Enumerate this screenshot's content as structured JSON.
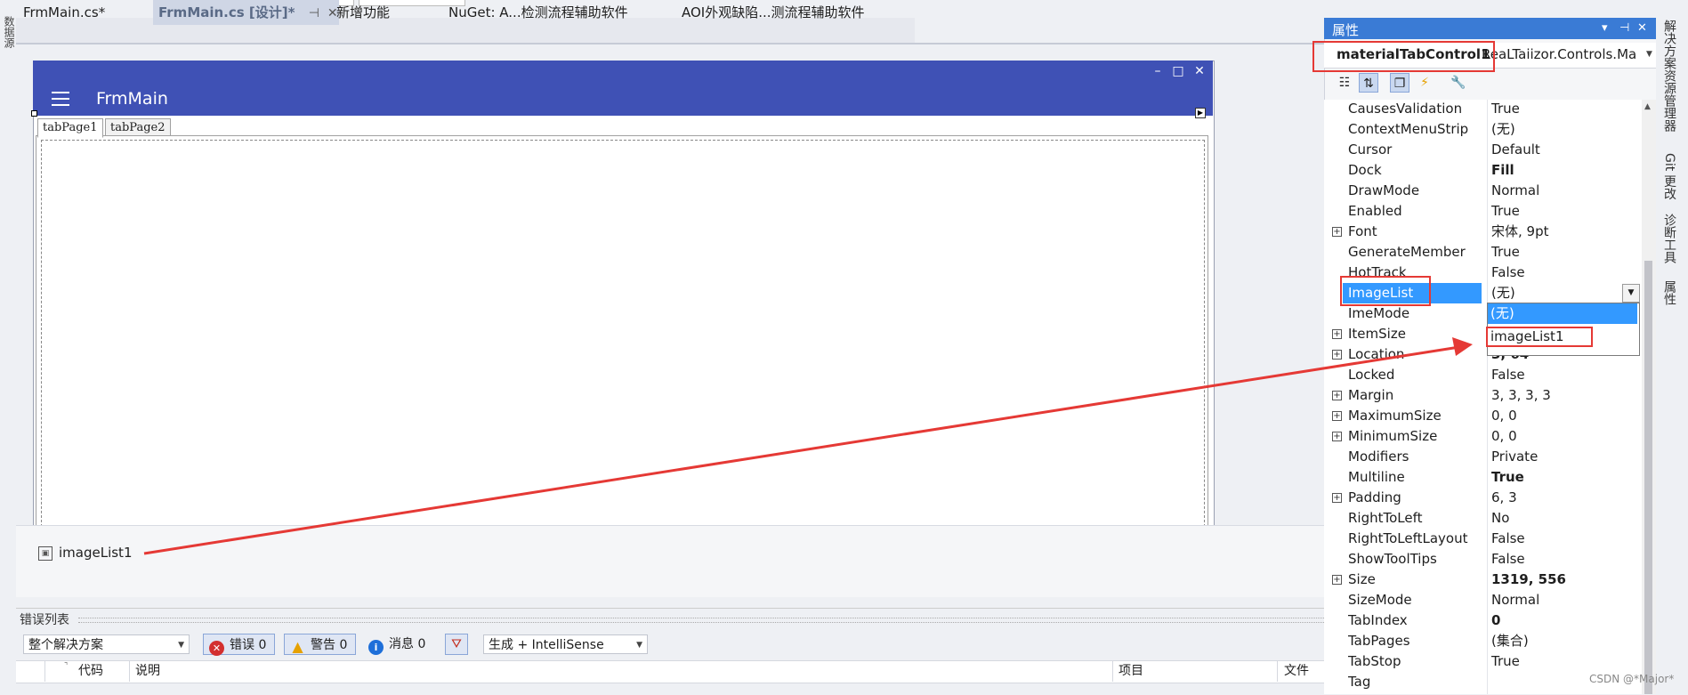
{
  "left_strip": {
    "label": "数据源"
  },
  "doc_tabs": [
    {
      "label": "FrmMain.cs*"
    },
    {
      "label": "FrmMain.cs [设计]*",
      "pin": "⊣",
      "close": "✕"
    },
    {
      "label": "新增功能"
    },
    {
      "label": "NuGet: A...检测流程辅助软件"
    },
    {
      "label": "AOI外观缺陷...测流程辅助软件"
    }
  ],
  "form": {
    "title": "FrmMain",
    "window_buttons": {
      "minimize": "–",
      "maximize": "□",
      "close": "✕"
    },
    "tabs": [
      "tabPage1",
      "tabPage2"
    ]
  },
  "tray": {
    "component": "imageList1"
  },
  "error_list": {
    "title": "错误列表",
    "scope": "整个解决方案",
    "errors": "错误 0",
    "warnings": "警告 0",
    "messages": "消息 0",
    "build_filter": "生成 + IntelliSense",
    "columns": [
      "代码",
      "说明",
      "项目",
      "文件"
    ]
  },
  "properties": {
    "title": "属性",
    "title_buttons": [
      "▾",
      "⊣",
      "✕"
    ],
    "object_name": "materialTabControl1",
    "object_type": "ReaLTaiizor.Controls.Ma",
    "rows": [
      {
        "name": "CausesValidation",
        "value": "True",
        "expandable": false,
        "bold": false
      },
      {
        "name": "ContextMenuStrip",
        "value": "(无)",
        "expandable": false,
        "bold": false
      },
      {
        "name": "Cursor",
        "value": "Default",
        "expandable": false,
        "bold": false
      },
      {
        "name": "Dock",
        "value": "Fill",
        "expandable": false,
        "bold": true
      },
      {
        "name": "DrawMode",
        "value": "Normal",
        "expandable": false,
        "bold": false
      },
      {
        "name": "Enabled",
        "value": "True",
        "expandable": false,
        "bold": false
      },
      {
        "name": "Font",
        "value": "宋体, 9pt",
        "expandable": true,
        "bold": false
      },
      {
        "name": "GenerateMember",
        "value": "True",
        "expandable": false,
        "bold": false
      },
      {
        "name": "HotTrack",
        "value": "False",
        "expandable": false,
        "bold": false
      },
      {
        "name": "ImageList",
        "value": "(无)",
        "expandable": false,
        "bold": false,
        "selected": true
      },
      {
        "name": "ImeMode",
        "value": "",
        "expandable": false,
        "bold": false
      },
      {
        "name": "ItemSize",
        "value": "",
        "expandable": true,
        "bold": false
      },
      {
        "name": "Location",
        "value": "3, 64",
        "expandable": true,
        "bold": true
      },
      {
        "name": "Locked",
        "value": "False",
        "expandable": false,
        "bold": false
      },
      {
        "name": "Margin",
        "value": "3, 3, 3, 3",
        "expandable": true,
        "bold": false
      },
      {
        "name": "MaximumSize",
        "value": "0, 0",
        "expandable": true,
        "bold": false
      },
      {
        "name": "MinimumSize",
        "value": "0, 0",
        "expandable": true,
        "bold": false
      },
      {
        "name": "Modifiers",
        "value": "Private",
        "expandable": false,
        "bold": false
      },
      {
        "name": "Multiline",
        "value": "True",
        "expandable": false,
        "bold": true
      },
      {
        "name": "Padding",
        "value": "6, 3",
        "expandable": true,
        "bold": false
      },
      {
        "name": "RightToLeft",
        "value": "No",
        "expandable": false,
        "bold": false
      },
      {
        "name": "RightToLeftLayout",
        "value": "False",
        "expandable": false,
        "bold": false
      },
      {
        "name": "ShowToolTips",
        "value": "False",
        "expandable": false,
        "bold": false
      },
      {
        "name": "Size",
        "value": "1319, 556",
        "expandable": true,
        "bold": true
      },
      {
        "name": "SizeMode",
        "value": "Normal",
        "expandable": false,
        "bold": false
      },
      {
        "name": "TabIndex",
        "value": "0",
        "expandable": false,
        "bold": true
      },
      {
        "name": "TabPages",
        "value": "(集合)",
        "expandable": false,
        "bold": false
      },
      {
        "name": "TabStop",
        "value": "True",
        "expandable": false,
        "bold": false
      },
      {
        "name": "Tag",
        "value": "",
        "expandable": false,
        "bold": false
      }
    ],
    "dropdown_options": [
      "(无)",
      "imageList1"
    ]
  },
  "right_strip": [
    "解决方案资源管理器",
    "Git 更改",
    "诊断工具",
    "属性"
  ],
  "watermark": "CSDN @*Major*",
  "annotation_color": "#e53935"
}
